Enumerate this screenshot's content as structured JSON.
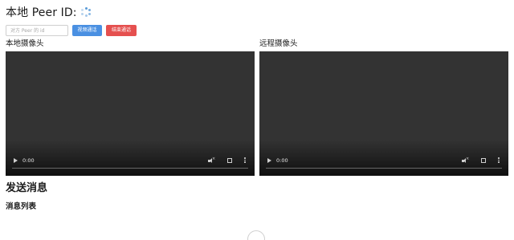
{
  "header": {
    "peer_id_label": "本地 Peer ID:"
  },
  "controls": {
    "peer_input_placeholder": "对方 Peer 的 id",
    "video_call_label": "视频通话",
    "end_call_label": "结束通话"
  },
  "cameras": {
    "local_label": "本地摄像头",
    "remote_label": "远程摄像头",
    "local_time": "0:00",
    "remote_time": "0:00"
  },
  "messages": {
    "send_heading": "发送消息",
    "list_heading": "消息列表"
  },
  "colors": {
    "video_call_button": "#4a90e2",
    "end_call_button": "#e5504f",
    "video_background": "#333333",
    "spinner": "#5a9bd8"
  }
}
